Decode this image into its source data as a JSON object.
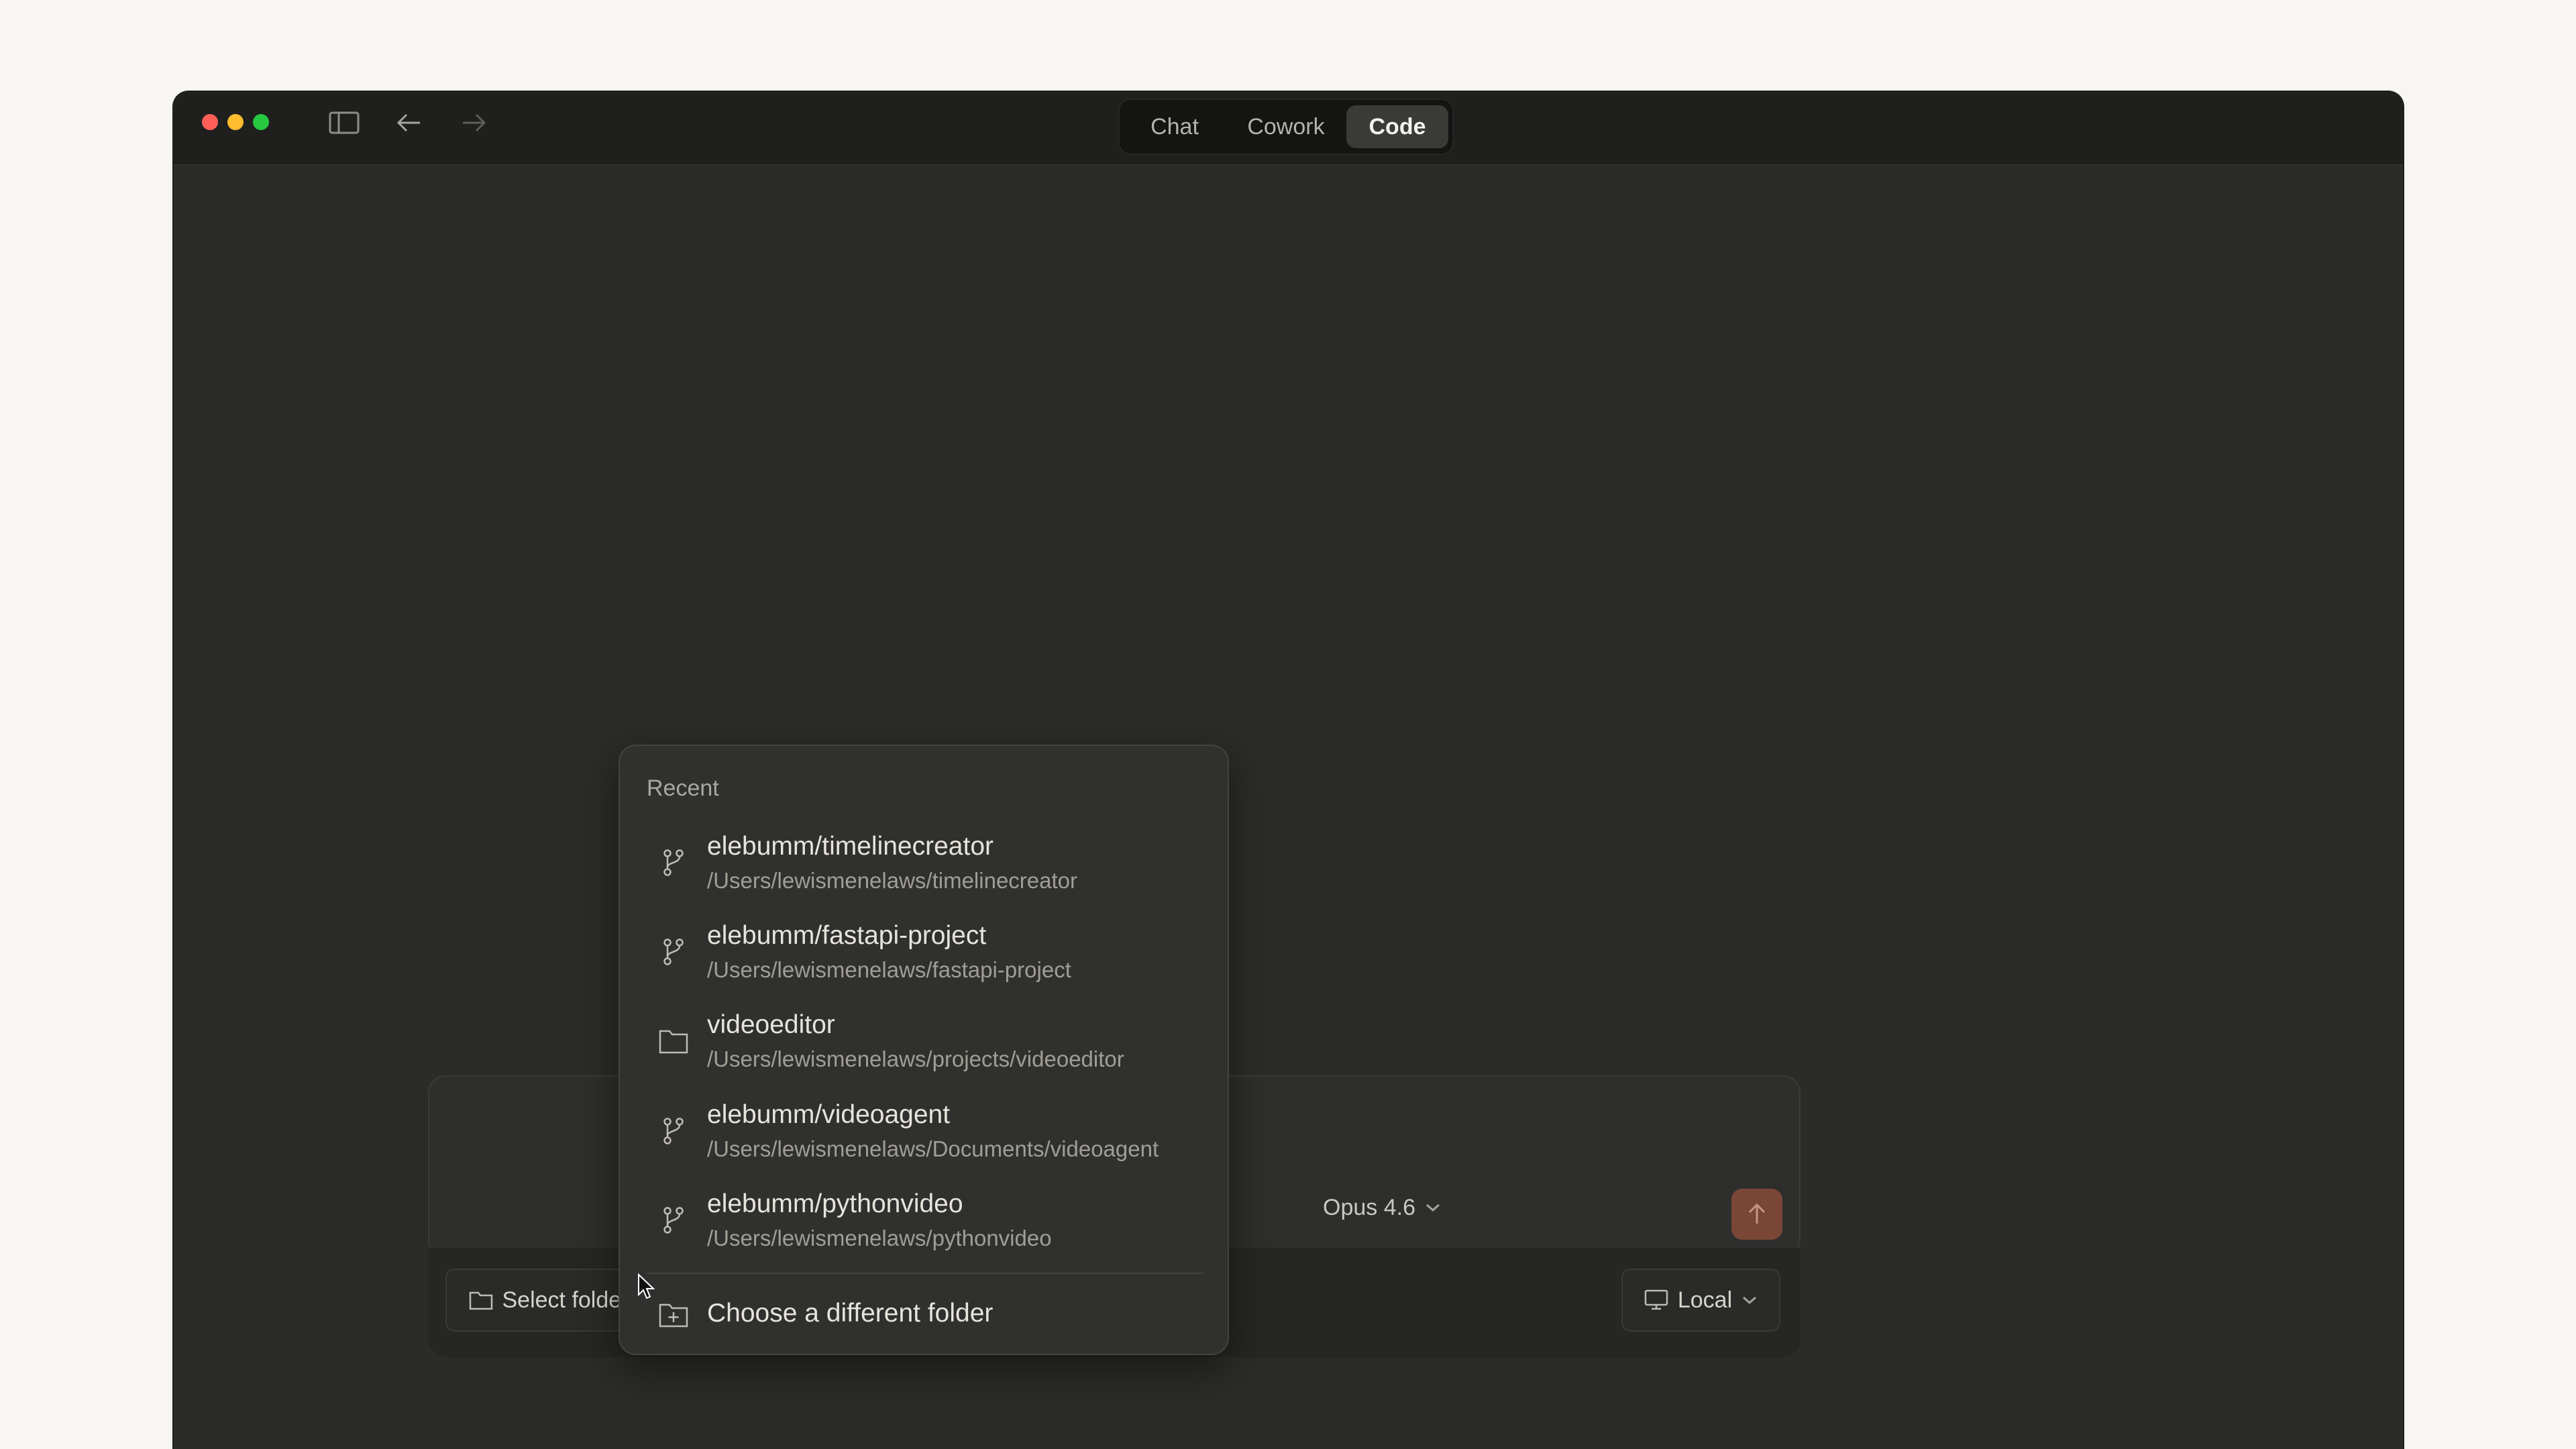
{
  "window": {
    "nav": {
      "sidebar_icon": "sidebar-toggle-icon",
      "back_icon": "arrow-left-icon",
      "forward_icon": "arrow-right-icon"
    },
    "mode_tabs": [
      {
        "label": "Chat",
        "active": false
      },
      {
        "label": "Cowork",
        "active": false
      },
      {
        "label": "Code",
        "active": true
      }
    ]
  },
  "composer": {
    "model_label": "Opus 4.6",
    "send_icon": "arrow-up-icon",
    "select_folder_label": "Select folder",
    "environment_label": "Local"
  },
  "folder_dropdown": {
    "header": "Recent",
    "items": [
      {
        "name": "elebumm/timelinecreator",
        "path": "/Users/lewismenelaws/timelinecreator",
        "icon": "git-branch-icon"
      },
      {
        "name": "elebumm/fastapi-project",
        "path": "/Users/lewismenelaws/fastapi-project",
        "icon": "git-branch-icon"
      },
      {
        "name": "videoeditor",
        "path": "/Users/lewismenelaws/projects/videoeditor",
        "icon": "folder-icon"
      },
      {
        "name": "elebumm/videoagent",
        "path": "/Users/lewismenelaws/Documents/videoagent",
        "icon": "git-branch-icon"
      },
      {
        "name": "elebumm/pythonvideo",
        "path": "/Users/lewismenelaws/pythonvideo",
        "icon": "git-branch-icon"
      }
    ],
    "choose_label": "Choose a different folder"
  },
  "colors": {
    "accent_send": "#7a4636",
    "window_bg": "#2b2b29",
    "titlebar_bg": "#1f1f1e"
  }
}
